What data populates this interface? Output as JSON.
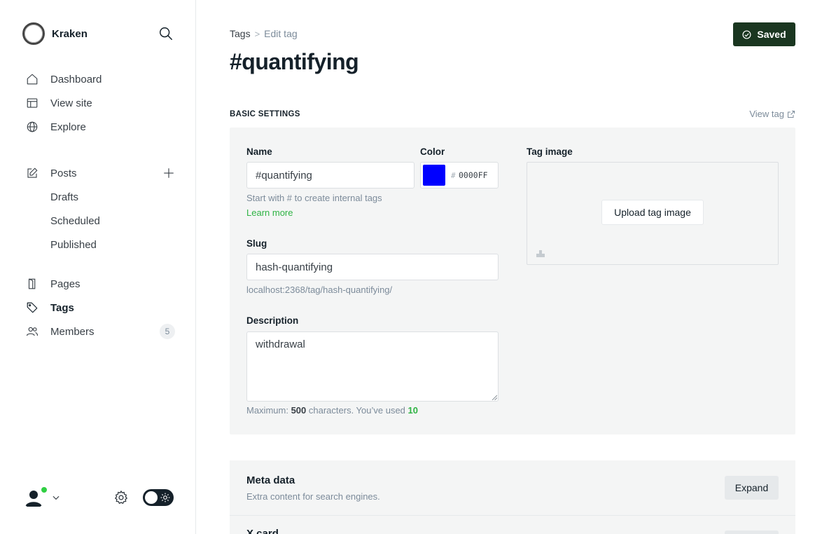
{
  "brand": {
    "name": "Kraken"
  },
  "nav": {
    "primary": [
      {
        "label": "Dashboard",
        "icon": "home-icon"
      },
      {
        "label": "View site",
        "icon": "layout-icon"
      },
      {
        "label": "Explore",
        "icon": "globe-icon"
      }
    ],
    "posts": {
      "label": "Posts",
      "icon": "edit-icon",
      "sub": [
        "Drafts",
        "Scheduled",
        "Published"
      ]
    },
    "secondary": [
      {
        "label": "Pages",
        "icon": "pages-icon"
      },
      {
        "label": "Tags",
        "icon": "tag-icon",
        "active": true
      },
      {
        "label": "Members",
        "icon": "members-icon",
        "count": "5"
      }
    ]
  },
  "header": {
    "breadcrumb": {
      "parent": "Tags",
      "separator": ">",
      "current": "Edit tag"
    },
    "title": "#quantifying",
    "saved_label": "Saved"
  },
  "basic_settings": {
    "section_label": "BASIC SETTINGS",
    "view_tag_label": "View tag",
    "name": {
      "label": "Name",
      "value": "#quantifying",
      "hint": "Start with # to create internal tags",
      "learn_more": "Learn more"
    },
    "color": {
      "label": "Color",
      "hash": "#",
      "value": "0000FF",
      "swatch": "#0000ff"
    },
    "slug": {
      "label": "Slug",
      "value": "hash-quantifying",
      "url": "localhost:2368/tag/hash-quantifying/"
    },
    "description": {
      "label": "Description",
      "value": "withdrawal",
      "counter_prefix": "Maximum: ",
      "max": "500",
      "counter_mid": " characters. You’ve used ",
      "used": "10"
    },
    "tag_image": {
      "label": "Tag image",
      "upload_label": "Upload tag image"
    }
  },
  "meta_data": {
    "title": "Meta data",
    "subtitle": "Extra content for search engines.",
    "expand_label": "Expand"
  },
  "x_card": {
    "title": "X card"
  },
  "colors": {
    "accent": "#30cf43",
    "saved_bg": "#1a3620",
    "text": "#15212a"
  }
}
